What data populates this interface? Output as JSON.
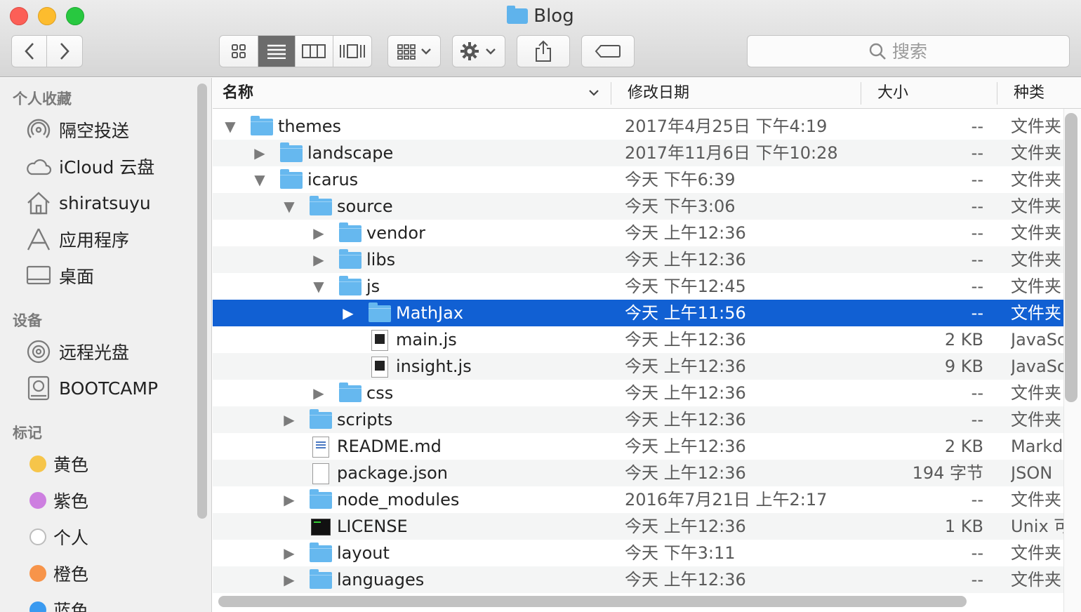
{
  "window": {
    "title": "Blog"
  },
  "toolbar": {
    "search_placeholder": "搜索"
  },
  "sidebar": {
    "sections": [
      {
        "heading": "个人收藏",
        "items": [
          {
            "label": "隔空投送",
            "icon": "airdrop-icon"
          },
          {
            "label": "iCloud 云盘",
            "icon": "cloud-icon"
          },
          {
            "label": "shiratsuyu",
            "icon": "home-icon"
          },
          {
            "label": "应用程序",
            "icon": "applications-icon"
          },
          {
            "label": "桌面",
            "icon": "desktop-icon"
          }
        ]
      },
      {
        "heading": "设备",
        "items": [
          {
            "label": "远程光盘",
            "icon": "disc-icon"
          },
          {
            "label": "BOOTCAMP",
            "icon": "drive-icon"
          }
        ]
      },
      {
        "heading": "标记",
        "items": [
          {
            "label": "黄色",
            "color": "#f6c54a"
          },
          {
            "label": "紫色",
            "color": "#cd7fe0"
          },
          {
            "label": "个人",
            "color": "#ffffff"
          },
          {
            "label": "橙色",
            "color": "#f7944a"
          },
          {
            "label": "蓝色",
            "color": "#3a9af0"
          }
        ]
      }
    ]
  },
  "columns": {
    "name": "名称",
    "date": "修改日期",
    "size": "大小",
    "kind": "种类"
  },
  "files": [
    {
      "name": "themes",
      "date": "2017年4月25日 下午4:19",
      "size": "--",
      "kind": "文件夹",
      "type": "folder",
      "depth": 0,
      "disclosure": "open"
    },
    {
      "name": "landscape",
      "date": "2017年11月6日 下午10:28",
      "size": "--",
      "kind": "文件夹",
      "type": "folder",
      "depth": 1,
      "disclosure": "closed"
    },
    {
      "name": "icarus",
      "date": "今天 下午6:39",
      "size": "--",
      "kind": "文件夹",
      "type": "folder",
      "depth": 1,
      "disclosure": "open"
    },
    {
      "name": "source",
      "date": "今天 下午3:06",
      "size": "--",
      "kind": "文件夹",
      "type": "folder",
      "depth": 2,
      "disclosure": "open"
    },
    {
      "name": "vendor",
      "date": "今天 上午12:36",
      "size": "--",
      "kind": "文件夹",
      "type": "folder",
      "depth": 3,
      "disclosure": "closed"
    },
    {
      "name": "libs",
      "date": "今天 上午12:36",
      "size": "--",
      "kind": "文件夹",
      "type": "folder",
      "depth": 3,
      "disclosure": "closed"
    },
    {
      "name": "js",
      "date": "今天 下午12:45",
      "size": "--",
      "kind": "文件夹",
      "type": "folder",
      "depth": 3,
      "disclosure": "open"
    },
    {
      "name": "MathJax",
      "date": "今天 上午11:56",
      "size": "--",
      "kind": "文件夹",
      "type": "folder",
      "depth": 4,
      "disclosure": "closed",
      "selected": true
    },
    {
      "name": "main.js",
      "date": "今天 上午12:36",
      "size": "2 KB",
      "kind": "JavaScript",
      "type": "js",
      "depth": 4,
      "disclosure": "none"
    },
    {
      "name": "insight.js",
      "date": "今天 上午12:36",
      "size": "9 KB",
      "kind": "JavaScript",
      "type": "js",
      "depth": 4,
      "disclosure": "none"
    },
    {
      "name": "css",
      "date": "今天 上午12:36",
      "size": "--",
      "kind": "文件夹",
      "type": "folder",
      "depth": 3,
      "disclosure": "closed"
    },
    {
      "name": "scripts",
      "date": "今天 上午12:36",
      "size": "--",
      "kind": "文件夹",
      "type": "folder",
      "depth": 2,
      "disclosure": "closed"
    },
    {
      "name": "README.md",
      "date": "今天 上午12:36",
      "size": "2 KB",
      "kind": "Markdown",
      "type": "md",
      "depth": 2,
      "disclosure": "none"
    },
    {
      "name": "package.json",
      "date": "今天 上午12:36",
      "size": "194 字节",
      "kind": "JSON",
      "type": "file",
      "depth": 2,
      "disclosure": "none"
    },
    {
      "name": "node_modules",
      "date": "2016年7月21日 上午2:17",
      "size": "--",
      "kind": "文件夹",
      "type": "folder",
      "depth": 2,
      "disclosure": "closed"
    },
    {
      "name": "LICENSE",
      "date": "今天 上午12:36",
      "size": "1 KB",
      "kind": "Unix 可执行文件",
      "type": "exec",
      "depth": 2,
      "disclosure": "none"
    },
    {
      "name": "layout",
      "date": "今天 下午3:11",
      "size": "--",
      "kind": "文件夹",
      "type": "folder",
      "depth": 2,
      "disclosure": "closed"
    },
    {
      "name": "languages",
      "date": "今天 上午12:36",
      "size": "--",
      "kind": "文件夹",
      "type": "folder",
      "depth": 2,
      "disclosure": "closed"
    }
  ]
}
